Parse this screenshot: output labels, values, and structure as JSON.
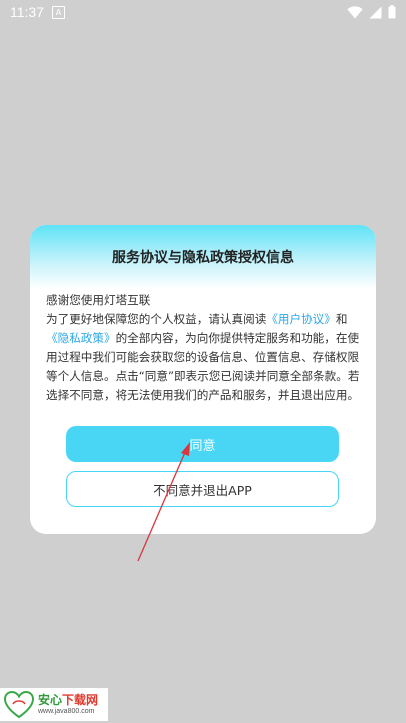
{
  "status_bar": {
    "time": "11:37",
    "notification_letter": "A"
  },
  "dialog": {
    "title": "服务协议与隐私政策授权信息",
    "greeting": "感谢您使用灯塔互联",
    "body_part1": "为了更好地保障您的个人权益，请认真阅读",
    "link_user_agreement": "《用户协议》",
    "body_and": "和",
    "link_privacy_policy": "《隐私政策》",
    "body_part2": "的全部内容，为向你提供特定服务和功能，在使用过程中我们可能会获取您的设备信息、位置信息、存储权限等个人信息。点击“同意”即表示您已阅读并同意全部条款。若选择不同意，将无法使用我们的产品和服务，并且退出应用。",
    "agree_button_label": "同意",
    "disagree_button_label": "不同意并退出APP"
  },
  "watermark": {
    "logo_text": "安心",
    "title_left": "安心",
    "title_right": "下载网",
    "url": "www.java800.com"
  },
  "colors": {
    "accent": "#48d6f4",
    "link": "#2ea8e6",
    "arrow": "#d9363e",
    "page_background": "#cfcfcf"
  }
}
